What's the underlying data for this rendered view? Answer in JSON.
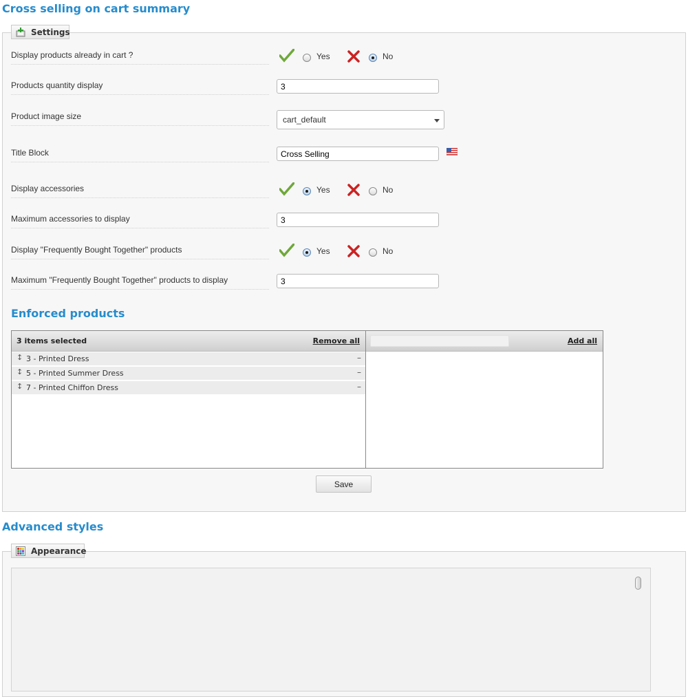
{
  "module": {
    "title": "Cross selling on cart summary"
  },
  "settings": {
    "legend": "Settings",
    "display_in_cart": {
      "label": "Display products already in cart ?",
      "yes": "Yes",
      "no": "No",
      "selected": "No"
    },
    "quantity": {
      "label": "Products quantity display",
      "value": "3"
    },
    "image_size": {
      "label": "Product image size",
      "value": "cart_default"
    },
    "title_block": {
      "label": "Title Block",
      "value": "Cross Selling"
    },
    "display_accessories": {
      "label": "Display accessories",
      "yes": "Yes",
      "no": "No",
      "selected": "Yes"
    },
    "max_accessories": {
      "label": "Maximum accessories to display",
      "value": "3"
    },
    "display_fbt": {
      "label": "Display \"Frequently Bought Together\" products",
      "yes": "Yes",
      "no": "No",
      "selected": "Yes"
    },
    "max_fbt": {
      "label": "Maximum \"Frequently Bought Together\" products to display",
      "value": "3"
    }
  },
  "enforced": {
    "title": "Enforced products",
    "selected_header": "3 items selected",
    "remove_all": "Remove all",
    "add_all": "Add all",
    "items": [
      {
        "label": "3 - Printed Dress"
      },
      {
        "label": "5 - Printed Summer Dress"
      },
      {
        "label": "7 - Printed Chiffon Dress"
      }
    ],
    "drag_glyph": "↕",
    "remove_glyph": "–"
  },
  "actions": {
    "save_label": "Save"
  },
  "advanced": {
    "title": "Advanced styles",
    "legend": "Appearance"
  },
  "colors": {
    "heading": "#268ccd",
    "check": "#6fa83a",
    "cross": "#cc2222"
  },
  "icons": {
    "settings_legend": "add-settings-icon",
    "appearance_legend": "palette-icon",
    "yes_indicator": "check-icon",
    "no_indicator": "x-icon",
    "language": "us-flag-icon"
  }
}
